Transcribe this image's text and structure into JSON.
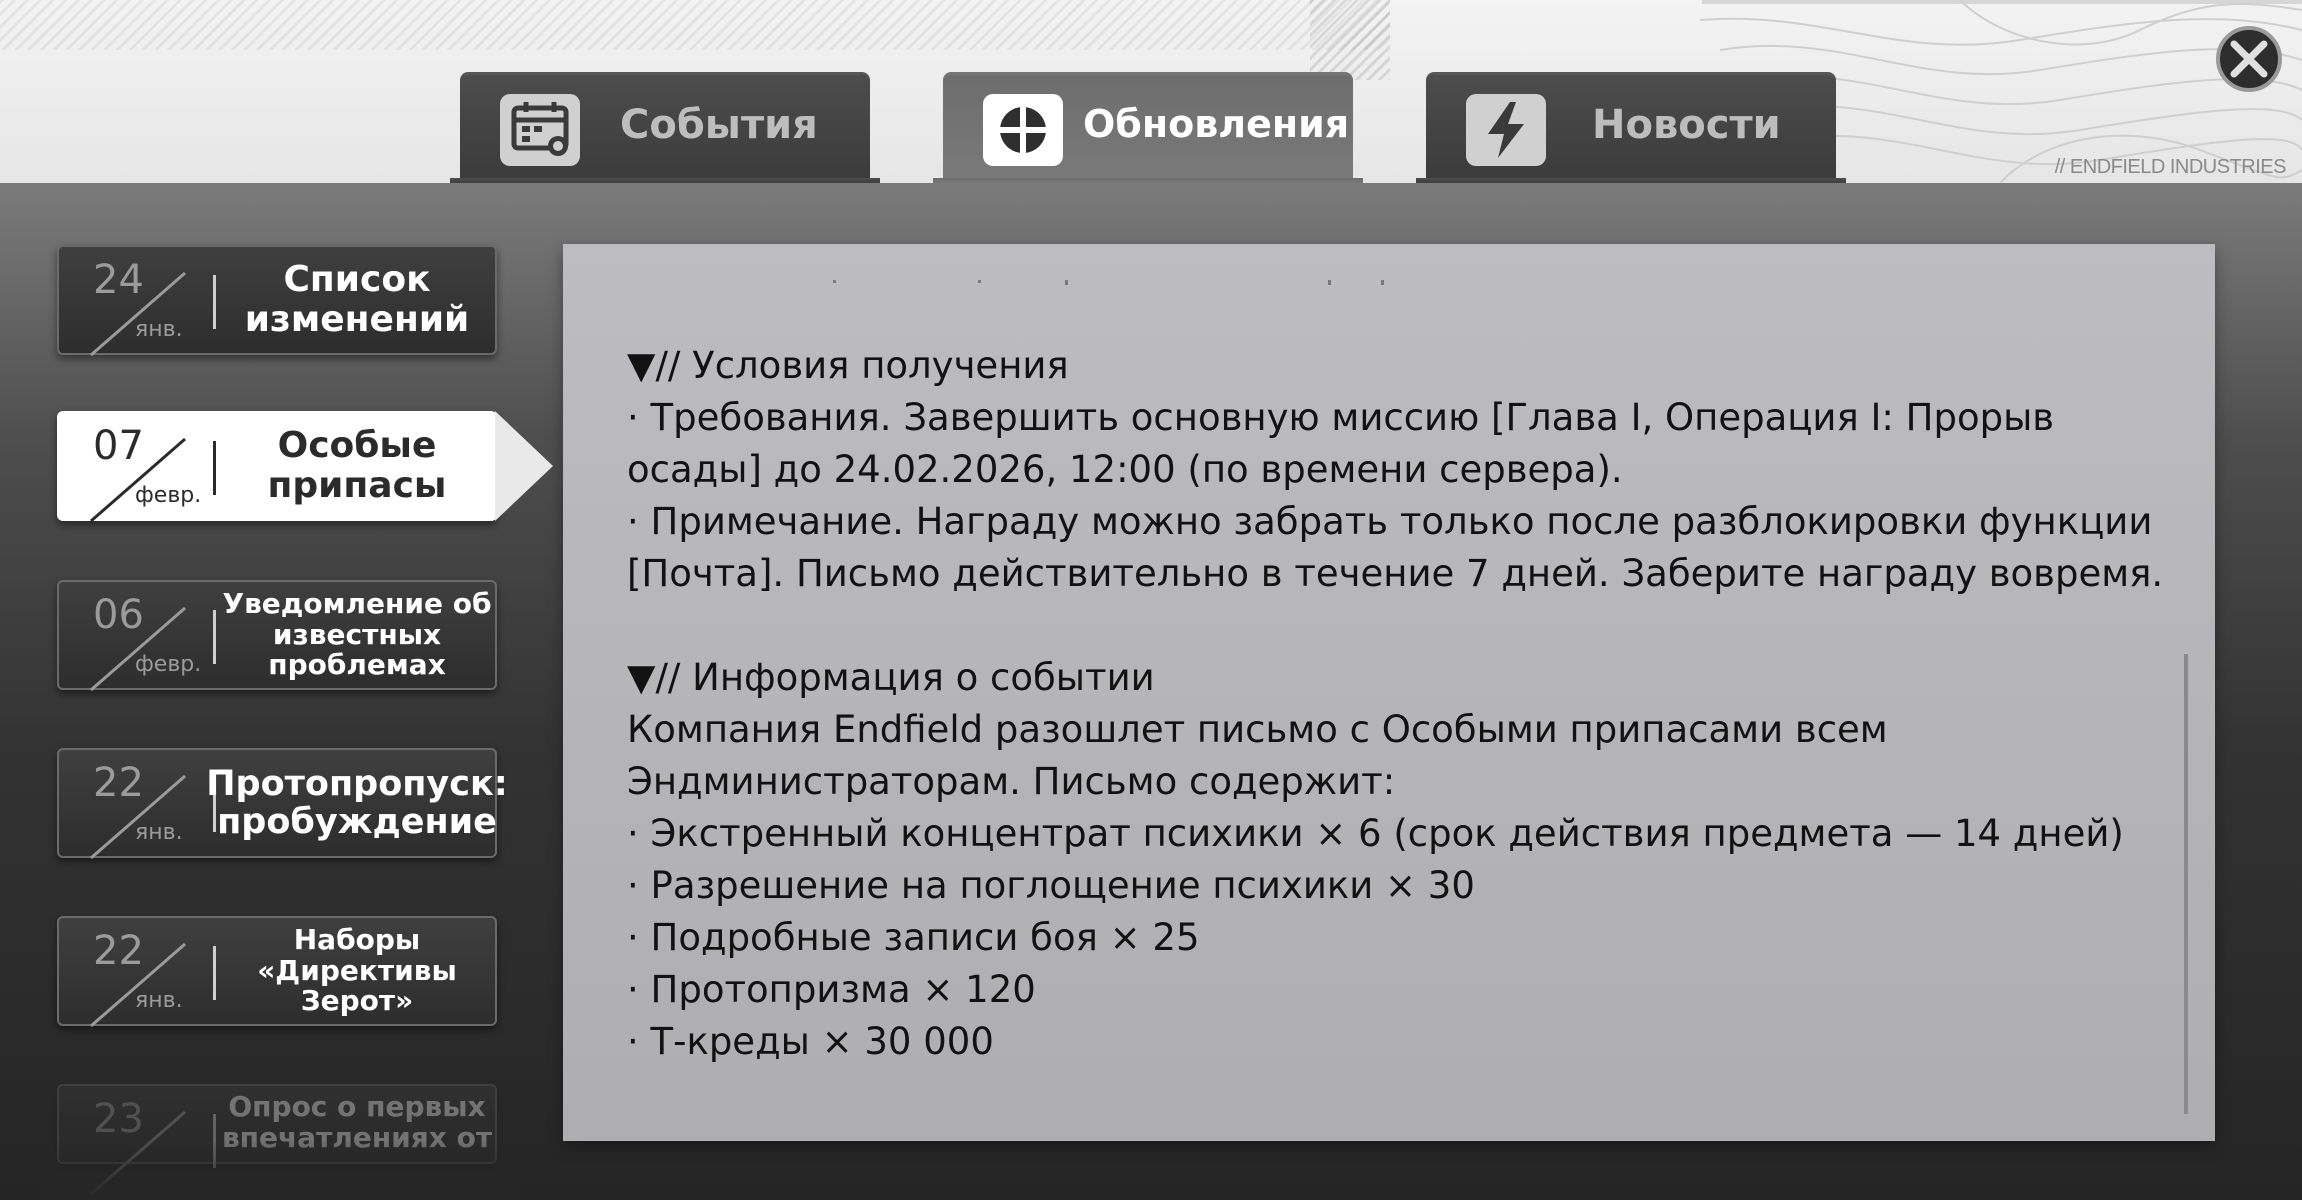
{
  "header": {
    "brand": "// ENDFIELD INDUSTRIES"
  },
  "tabs": [
    {
      "label": "События",
      "icon": "calendar-icon",
      "active": false
    },
    {
      "label": "Обновления",
      "icon": "crosshair-icon",
      "active": true
    },
    {
      "label": "Новости",
      "icon": "lightning-icon",
      "active": false
    }
  ],
  "sidebar": {
    "items": [
      {
        "day": "24",
        "month": "янв.",
        "title": "Список изменений"
      },
      {
        "day": "07",
        "month": "февр.",
        "title": "Особые припасы",
        "active": true
      },
      {
        "day": "06",
        "month": "февр.",
        "title": "Уведомление об известных проблемах"
      },
      {
        "day": "22",
        "month": "янв.",
        "title": "Протопропуск: пробуждение"
      },
      {
        "day": "22",
        "month": "янв.",
        "title": "Наборы «Директивы Зерот»"
      },
      {
        "day": "23",
        "month": "",
        "title": "Опрос о первых впечатлениях от"
      }
    ]
  },
  "content": {
    "section1_heading": "▼// Условия получения",
    "line1": "· Требования. Завершить основную миссию [Глава I, Операция I: Прорыв",
    "line2": "осады] до 24.02.2026, 12:00 (по времени сервера).",
    "line3": "· Примечание. Награду можно забрать только после разблокировки функции",
    "line4": "[Почта]. Письмо действительно в течение 7 дней. Заберите награду вовремя.",
    "section2_heading": "▼// Информация о событии",
    "line5": "Компания Endfield разошлет письмо с Особыми припасами всем",
    "line6": "Эндминистраторам. Письмо содержит:",
    "line7": "· Экстренный концентрат психики × 6 (срок действия предмета — 14 дней)",
    "line8": "· Разрешение на поглощение психики × 30",
    "line9": "· Подробные записи боя × 25",
    "line10": "· Протопризма × 120",
    "line11": "· Т-креды × 30 000"
  },
  "colors": {
    "active_item_bg": "#ffffff",
    "panel_bg": "#b8b8bb",
    "tab_bg": "#444444"
  }
}
